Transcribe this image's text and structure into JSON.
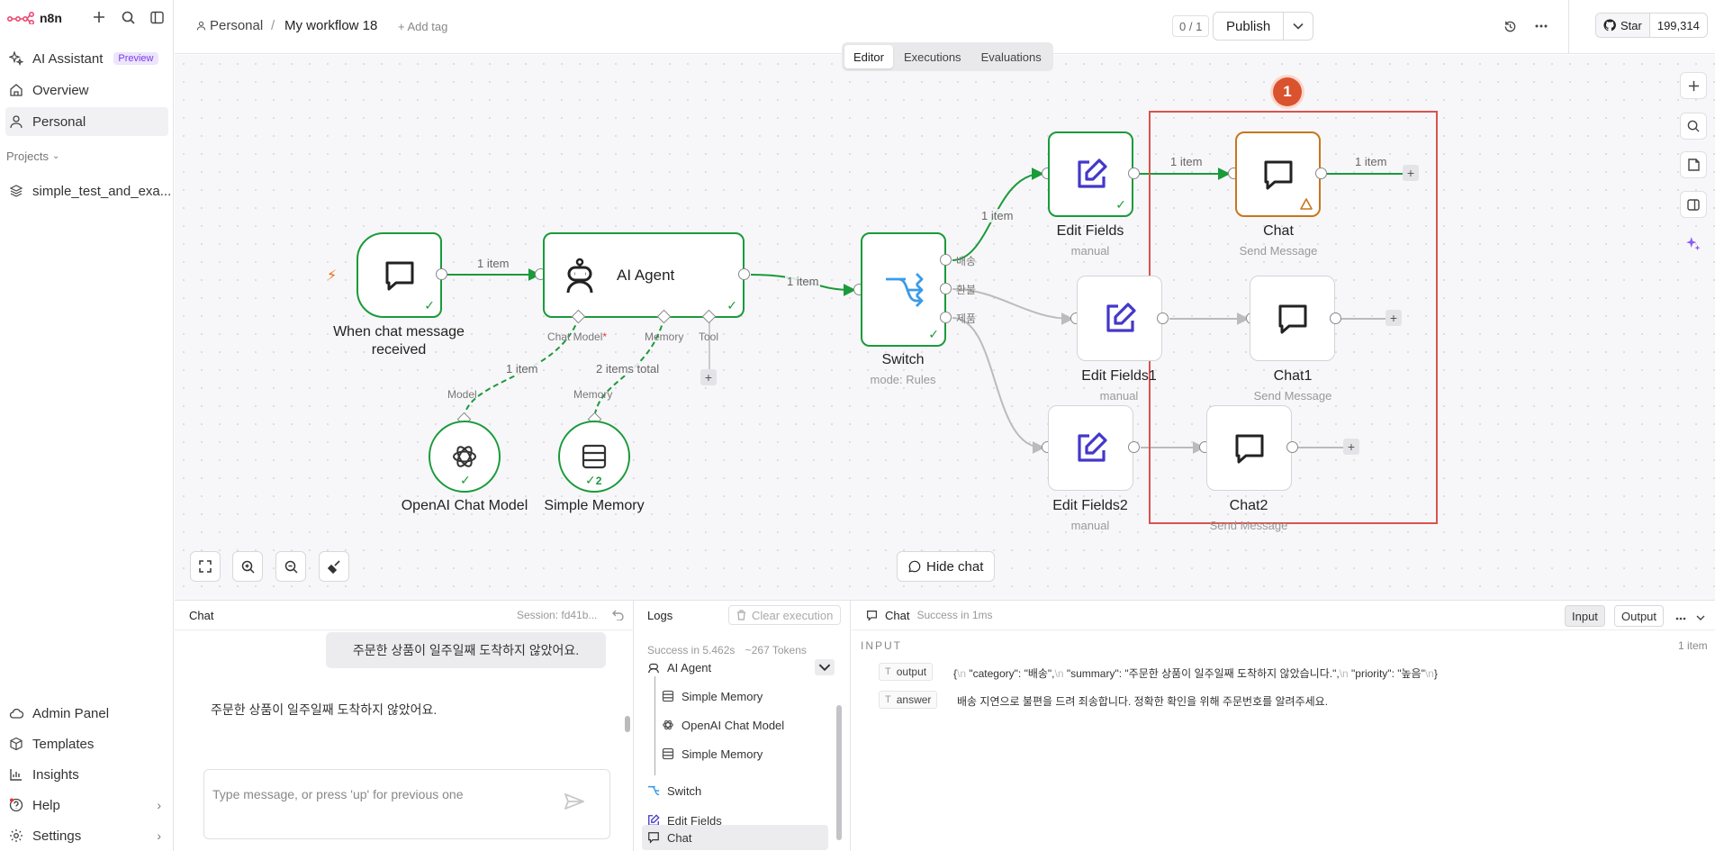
{
  "app": {
    "name": "n8n",
    "brand_color": "#ea4b71",
    "accent_green": "#1a9a3a",
    "warn_color": "#c8761c",
    "highlight_color": "#d9534f"
  },
  "sidebar": {
    "items": [
      {
        "label": "AI Assistant",
        "badge": "Preview",
        "icon": "sparkle-icon"
      },
      {
        "label": "Overview",
        "icon": "home-icon"
      },
      {
        "label": "Personal",
        "icon": "user-icon"
      }
    ],
    "projects_label": "Projects",
    "projects": [
      {
        "label": "simple_test_and_exa...",
        "icon": "layers-icon"
      }
    ],
    "bottom_items": [
      {
        "label": "Admin Panel",
        "icon": "cloud-icon"
      },
      {
        "label": "Templates",
        "icon": "box-icon"
      },
      {
        "label": "Insights",
        "icon": "chart-icon"
      },
      {
        "label": "Help",
        "icon": "help-icon"
      },
      {
        "label": "Settings",
        "icon": "gear-icon"
      }
    ]
  },
  "topbar": {
    "breadcrumb_project": "Personal",
    "separator": "/",
    "workflow_name": "My workflow 18",
    "add_tag": "+ Add tag",
    "counter": "0 / 1",
    "publish_label": "Publish",
    "github_star": "Star",
    "github_count": "199,314"
  },
  "canvas": {
    "tabs": [
      "Editor",
      "Executions",
      "Evaluations"
    ],
    "active_tab": "Editor",
    "hide_chat": "Hide chat",
    "step_badge": "1",
    "nodes": {
      "trigger": {
        "title": "When chat message",
        "title2": "received"
      },
      "agent": {
        "title": "AI Agent",
        "port_chat_model": "Chat Model",
        "required_mark": "*",
        "port_memory": "Memory",
        "port_tool": "Tool"
      },
      "openai": {
        "title": "OpenAI Chat Model",
        "port": "Model"
      },
      "memory": {
        "title": "Simple Memory",
        "port": "Memory",
        "count": "2"
      },
      "switch": {
        "title": "Switch",
        "sub": "mode: Rules",
        "out1": "배송",
        "out2": "환불",
        "out3": "제품"
      },
      "edit1": {
        "title": "Edit Fields",
        "sub": "manual"
      },
      "edit2": {
        "title": "Edit Fields1",
        "sub": "manual"
      },
      "edit3": {
        "title": "Edit Fields2",
        "sub": "manual"
      },
      "chat1": {
        "title": "Chat",
        "sub": "Send Message"
      },
      "chat2": {
        "title": "Chat1",
        "sub": "Send Message"
      },
      "chat3": {
        "title": "Chat2",
        "sub": "Send Message"
      }
    },
    "edges": {
      "trigger_agent": "1 item",
      "agent_switch": "1 item",
      "switch_edit": "1 item",
      "edit_chat": "1 item",
      "chat_out": "1 item",
      "model_link": "1 item",
      "memory_link": "2 items total"
    }
  },
  "chat_panel": {
    "title": "Chat",
    "session": "Session: fd41b...",
    "user_message": "주문한 상품이 일주일째 도착하지 않았어요.",
    "bot_message": "주문한 상품이 일주일째 도착하지 않았어요.",
    "input_placeholder": "Type message, or press 'up' for previous one"
  },
  "logs_panel": {
    "title": "Logs",
    "clear": "Clear execution",
    "status": "Success in 5.462s",
    "tokens": "~267 Tokens",
    "rows": [
      "AI Agent",
      "Simple Memory",
      "OpenAI Chat Model",
      "Simple Memory",
      "Switch",
      "Edit Fields",
      "Chat"
    ]
  },
  "detail_panel": {
    "node": "Chat",
    "status": "Success in 1ms",
    "input_tab": "Input",
    "output_tab": "Output",
    "section": "INPUT",
    "items": "1 item",
    "fields": [
      {
        "key": "output",
        "value_parts": [
          "{",
          "\\n",
          " \"category\": \"배송\",",
          "\\n",
          " \"summary\": \"주문한 상품이 일주일째 도착하지 않았습니다.\",",
          "\\n",
          " \"priority\": \"높음\"",
          "\\n",
          "}"
        ]
      },
      {
        "key": "answer",
        "value": "배송 지연으로 불편을 드려 죄송합니다. 정확한 확인을 위해 주문번호를 알려주세요."
      }
    ]
  }
}
